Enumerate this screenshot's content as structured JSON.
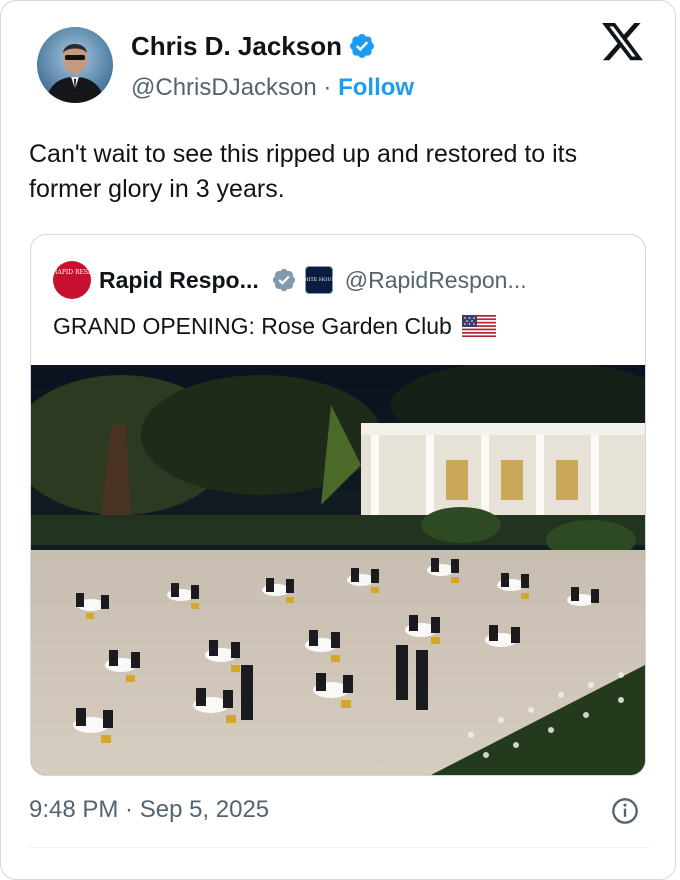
{
  "author": {
    "name": "Chris D. Jackson",
    "handle": "@ChrisDJackson",
    "separator": "·",
    "follow_label": "Follow",
    "verified_color": "#1d9bf0"
  },
  "tweet": {
    "text": "Can't wait to see this ripped up and restored to its former glory in 3 years.",
    "timestamp": "9:48 PM · Sep 5, 2025"
  },
  "quoted": {
    "name": "Rapid Respo...",
    "handle": "@RapidRespon...",
    "avatar_text": "RAPID RESPONSE",
    "affiliate_text": "WHITE HOUSE",
    "text": "GRAND OPENING: Rose Garden Club",
    "flag": "us-flag-icon",
    "badge_color": "#829aab"
  },
  "icons": {
    "platform": "x-logo-icon",
    "info": "info-icon"
  }
}
